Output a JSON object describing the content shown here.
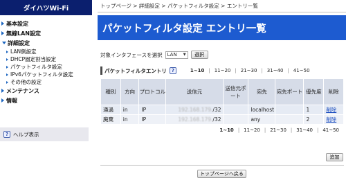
{
  "sidebar": {
    "brand": "ダイハツWi-Fi",
    "items": [
      {
        "label": "基本設定",
        "expanded": false
      },
      {
        "label": "無線LAN設定",
        "expanded": false
      },
      {
        "label": "詳細設定",
        "expanded": true,
        "children": [
          "LAN側設定",
          "DHCP固定割当設定",
          "パケットフィルタ設定",
          "IPv6パケットフィルタ設定",
          "その他の設定"
        ]
      },
      {
        "label": "メンテナンス",
        "expanded": false
      },
      {
        "label": "情報",
        "expanded": false
      }
    ],
    "help_label": "ヘルプ表示"
  },
  "breadcrumb": "トップページ > 詳細設定 > パケットフィルタ設定 > エントリー覧",
  "page_title": "パケットフィルタ設定 エントリ一覧",
  "interface": {
    "label": "対象インタフェースを選択",
    "selected": "LAN",
    "button": "選択"
  },
  "section": {
    "title": "パケットフィルタエントリ",
    "pages": [
      "1~10",
      "11~20",
      "21~30",
      "31~40",
      "41~50"
    ],
    "active_page": 0
  },
  "table": {
    "headers": [
      "種別",
      "方向",
      "プロトコル",
      "送信元",
      "送信元ポート",
      "宛先",
      "宛先ポート",
      "優先度",
      "削除"
    ],
    "rows": [
      {
        "type": "通過",
        "direction": "in",
        "protocol": "IP",
        "src_blur": "192.168.179.",
        "src_suffix": "/32",
        "src_port": "",
        "dst": "localhost",
        "dst_port": "",
        "priority": "1",
        "delete": "削除"
      },
      {
        "type": "廃棄",
        "direction": "in",
        "protocol": "IP",
        "src_blur": "192.168.179.",
        "src_suffix": "/32",
        "src_port": "",
        "dst": "any",
        "dst_port": "",
        "priority": "2",
        "delete": "削除"
      }
    ]
  },
  "add_button": "追加",
  "back_button": "トップページへ戻る"
}
